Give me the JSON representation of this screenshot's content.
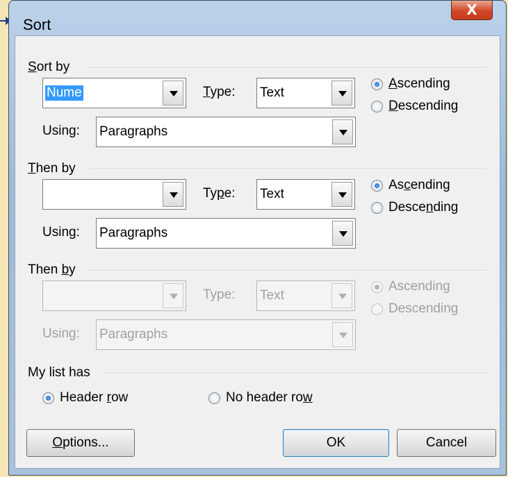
{
  "dialog": {
    "title": "Sort",
    "close_glyph": "X",
    "accent": "#d2472a"
  },
  "sort_by": {
    "label": "Sort by",
    "field_value": "Nume",
    "type_label": "Type:",
    "type_value": "Text",
    "using_label": "Using:",
    "using_value": "Paragraphs",
    "ascending": "Ascending",
    "descending": "Descending",
    "selected_order": "Ascending"
  },
  "then_by_1": {
    "label": "Then by",
    "field_value": "",
    "type_label": "Type:",
    "type_value": "Text",
    "using_label": "Using:",
    "using_value": "Paragraphs",
    "ascending": "Ascending",
    "descending": "Descending",
    "selected_order": "Ascending"
  },
  "then_by_2": {
    "label": "Then by",
    "field_value": "",
    "type_label": "Type:",
    "type_value": "Text",
    "using_label": "Using:",
    "using_value": "Paragraphs",
    "ascending": "Ascending",
    "descending": "Descending",
    "selected_order": "Ascending",
    "disabled": true
  },
  "list_has": {
    "label": "My list has",
    "header_row": "Header row",
    "no_header_row": "No header row",
    "selected": "Header row"
  },
  "buttons": {
    "options": "Options...",
    "ok": "OK",
    "cancel": "Cancel"
  }
}
